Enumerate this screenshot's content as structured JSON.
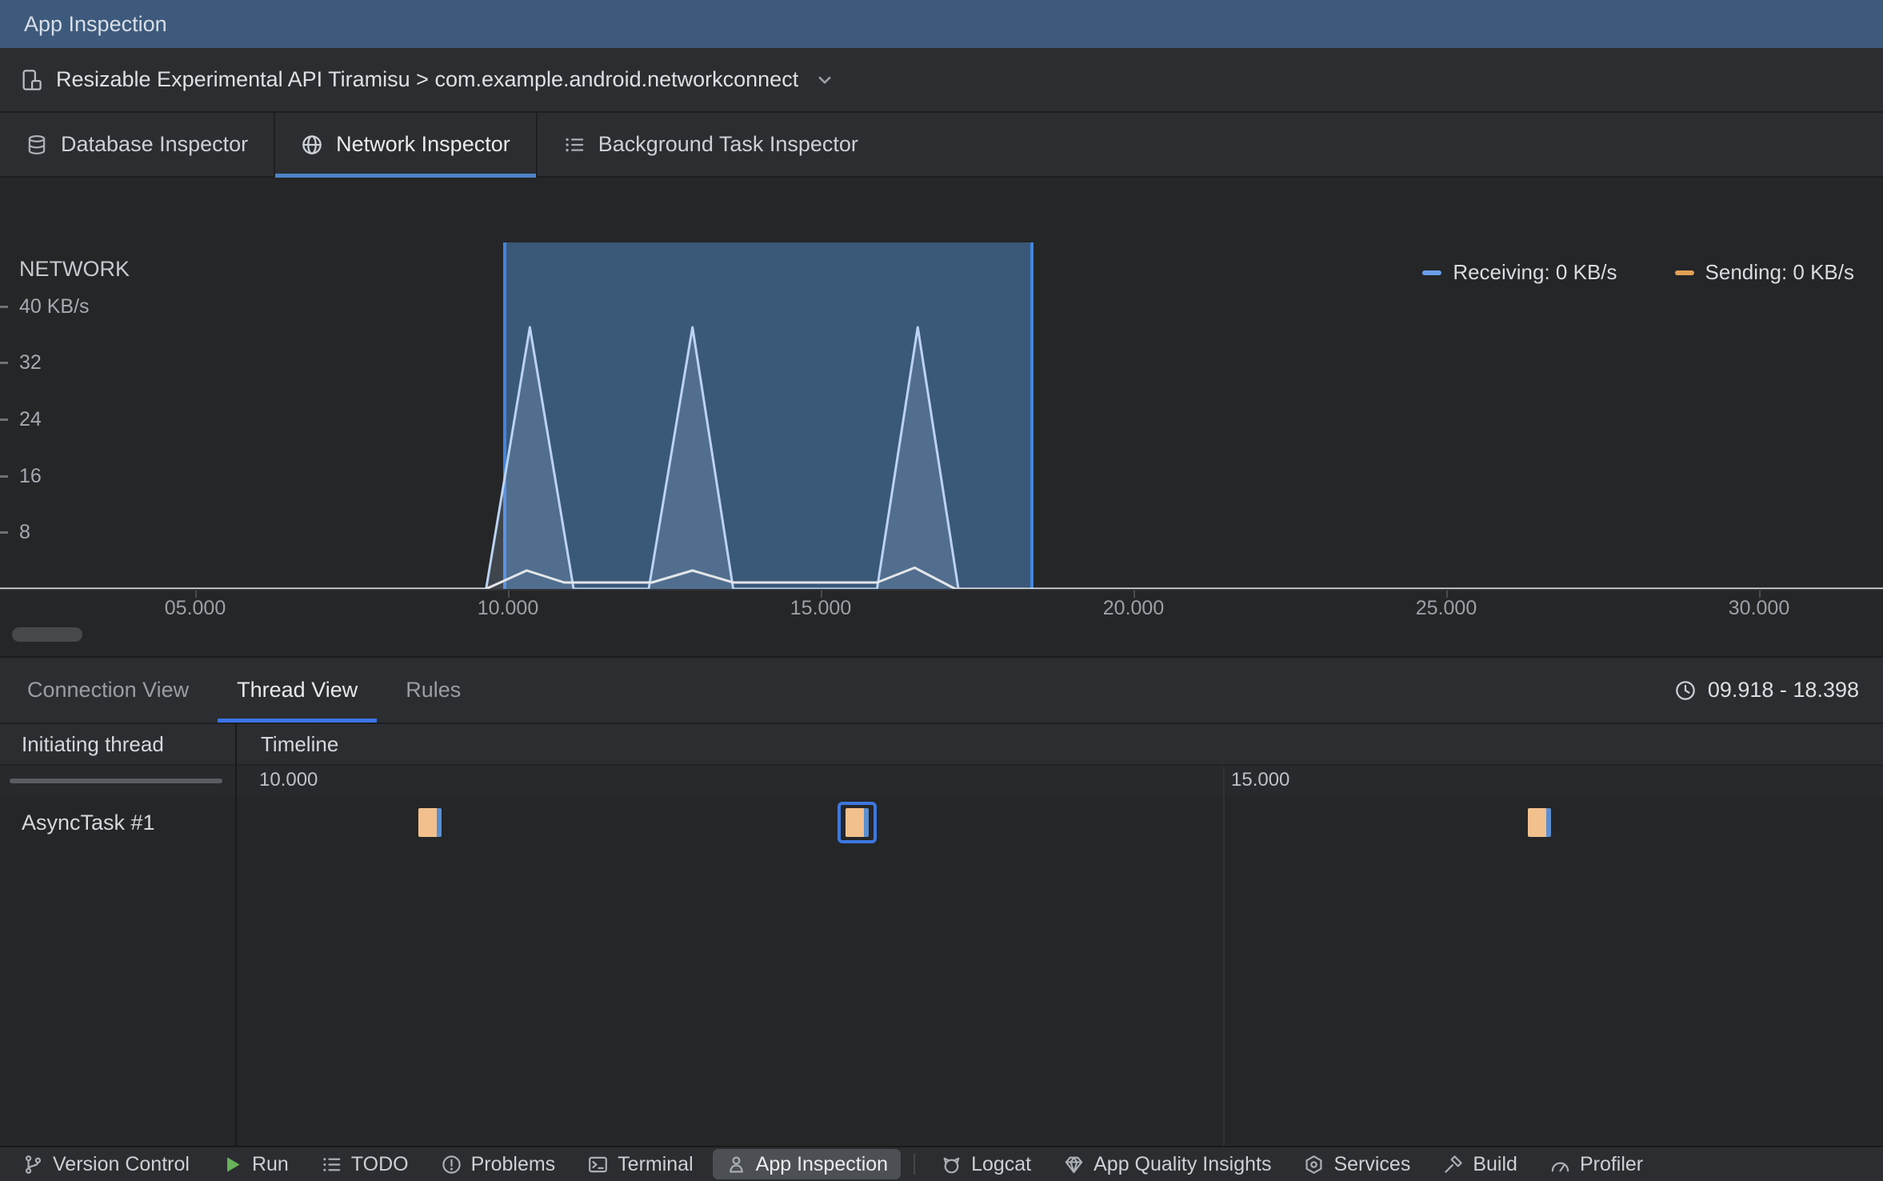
{
  "window": {
    "title": "App Inspection"
  },
  "process_bar": {
    "label": "Resizable Experimental API Tiramisu > com.example.android.networkconnect"
  },
  "inspector": {
    "tabs": [
      {
        "label": "Database Inspector",
        "selected": false
      },
      {
        "label": "Network Inspector",
        "selected": true
      },
      {
        "label": "Background Task Inspector",
        "selected": false
      }
    ]
  },
  "chart_data": {
    "type": "area",
    "title": "NETWORK",
    "y_ticks": [
      {
        "v": 8,
        "label": "8"
      },
      {
        "v": 16,
        "label": "16"
      },
      {
        "v": 24,
        "label": "24"
      },
      {
        "v": 32,
        "label": "32"
      },
      {
        "v": 40,
        "label": "40 KB/s"
      }
    ],
    "x_ticks": [
      {
        "t": 5,
        "label": "05.000"
      },
      {
        "t": 10,
        "label": "10.000"
      },
      {
        "t": 15,
        "label": "15.000"
      },
      {
        "t": 20,
        "label": "20.000"
      },
      {
        "t": 25,
        "label": "25.000"
      },
      {
        "t": 30,
        "label": "30.000"
      }
    ],
    "xlim": [
      1.88,
      31.98
    ],
    "ylim": [
      0,
      49
    ],
    "selection": {
      "start": 9.918,
      "end": 18.398
    },
    "legend": [
      {
        "label": "Receiving: 0 KB/s",
        "color": "#6A9DEB"
      },
      {
        "label": "Sending: 0 KB/s",
        "color": "#E2A054"
      }
    ],
    "series": [
      {
        "name": "receiving",
        "color": "#BCD3F4",
        "fill": "rgba(188,211,244,0.18)",
        "points": [
          [
            1.88,
            0
          ],
          [
            9.65,
            0
          ],
          [
            10.35,
            37
          ],
          [
            11.05,
            0
          ],
          [
            12.25,
            0
          ],
          [
            12.95,
            37
          ],
          [
            13.6,
            0
          ],
          [
            15.9,
            0
          ],
          [
            16.55,
            37
          ],
          [
            17.2,
            0
          ],
          [
            18.398,
            0
          ],
          [
            31.98,
            0
          ]
        ]
      },
      {
        "name": "sending",
        "color": "#E4E6E9",
        "points": [
          [
            1.88,
            0
          ],
          [
            9.65,
            0
          ],
          [
            10.3,
            2.6
          ],
          [
            10.9,
            0.9
          ],
          [
            12.3,
            0.9
          ],
          [
            12.95,
            2.6
          ],
          [
            13.6,
            0.9
          ],
          [
            15.9,
            0.9
          ],
          [
            16.5,
            3
          ],
          [
            17.15,
            0
          ],
          [
            31.98,
            0
          ]
        ]
      }
    ]
  },
  "thread_view": {
    "tabs": [
      {
        "label": "Connection View",
        "selected": false
      },
      {
        "label": "Thread View",
        "selected": true
      },
      {
        "label": "Rules",
        "selected": false
      }
    ],
    "range_label": "09.918 - 18.398",
    "columns": {
      "thread": "Initiating thread",
      "timeline": "Timeline"
    },
    "timeline": {
      "start": 9.918,
      "end": 18.398,
      "ticks": [
        {
          "t": 10.0,
          "label": "10.000",
          "grid": false
        },
        {
          "t": 15.0,
          "label": "15.000",
          "grid": true
        }
      ]
    },
    "rows": [
      {
        "thread": "AsyncTask #1",
        "events": [
          {
            "start": 10.86,
            "end": 10.98,
            "selected": false
          },
          {
            "start": 13.06,
            "end": 13.18,
            "selected": true
          },
          {
            "start": 16.57,
            "end": 16.69,
            "selected": false
          }
        ]
      }
    ]
  },
  "bottom_bar": {
    "items": [
      {
        "label": "Version Control",
        "icon": "branch-icon"
      },
      {
        "label": "Run",
        "icon": "run-icon"
      },
      {
        "label": "TODO",
        "icon": "todo-icon"
      },
      {
        "label": "Problems",
        "icon": "problems-icon"
      },
      {
        "label": "Terminal",
        "icon": "terminal-icon"
      },
      {
        "label": "App Inspection",
        "icon": "app-inspection-icon",
        "active": true
      },
      {
        "type": "separator"
      },
      {
        "label": "Logcat",
        "icon": "logcat-icon"
      },
      {
        "label": "App Quality Insights",
        "icon": "insights-icon"
      },
      {
        "label": "Services",
        "icon": "services-icon"
      },
      {
        "label": "Build",
        "icon": "build-icon"
      },
      {
        "label": "Profiler",
        "icon": "profiler-icon"
      }
    ]
  },
  "colors": {
    "accent": "#3574F0",
    "selection_fill": "#3A5878",
    "selection_border": "#4285DE",
    "event_fill": "#F2C08C",
    "event_edge": "#5A8FD2",
    "title_bar": "#3D5A7C"
  }
}
